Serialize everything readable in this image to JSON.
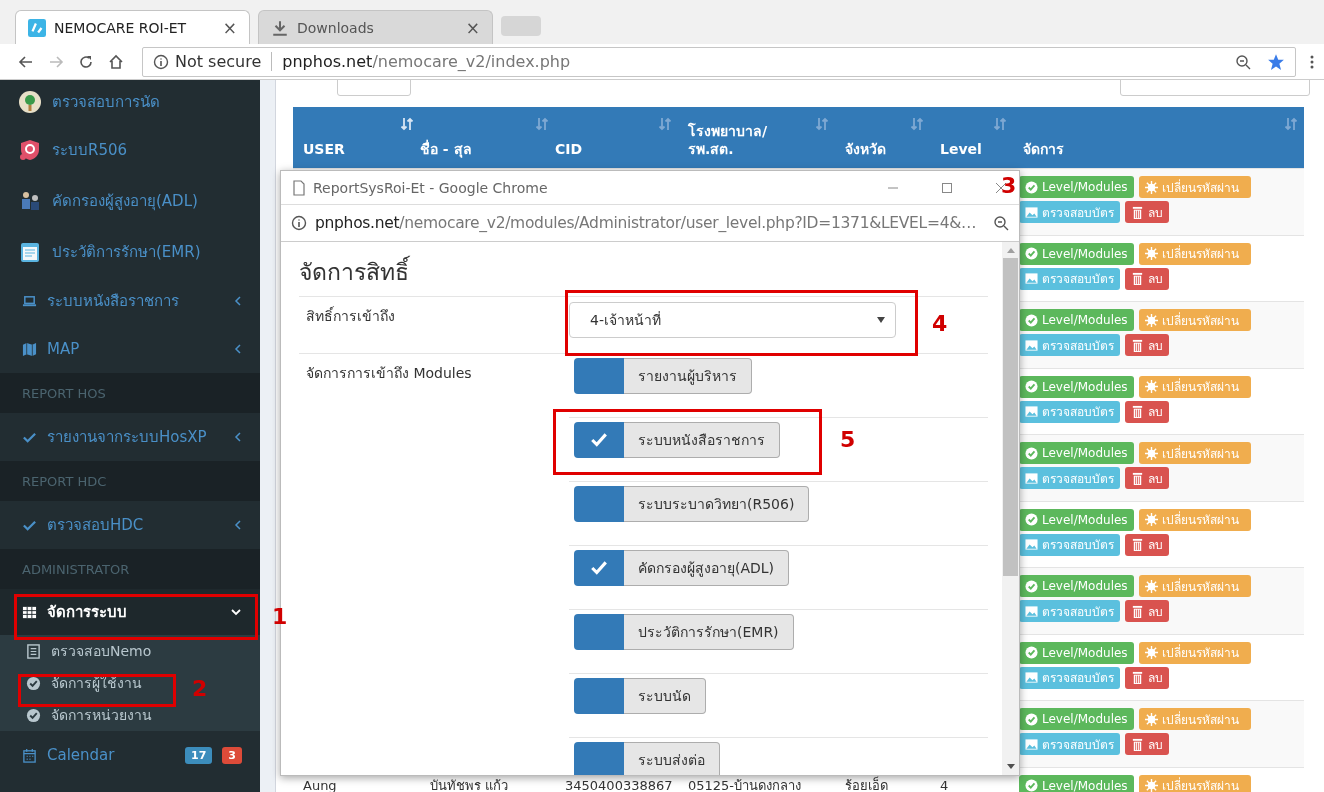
{
  "browser": {
    "tabs": [
      {
        "label": "NEMOCARE ROI-ET",
        "selected": true,
        "close": "×"
      },
      {
        "label": "Downloads",
        "selected": false,
        "close": "×"
      }
    ],
    "address": {
      "security": "Not secure",
      "host": "pnphos.net",
      "path": "/nemocare_v2/index.php"
    }
  },
  "sidebar": {
    "items": [
      {
        "kind": "item",
        "label": "ตรวจสอบการนัด",
        "selected": false
      },
      {
        "kind": "item",
        "label": "ระบบR506",
        "selected": false
      },
      {
        "kind": "item",
        "label": "คัดกรองผู้สูงอายุ(ADL)",
        "selected": false
      },
      {
        "kind": "item",
        "label": "ประวัติการรักษา(EMR)",
        "selected": false
      },
      {
        "kind": "item",
        "label": "ระบบหนังสือราชการ",
        "selected": false,
        "expanded": false
      },
      {
        "kind": "item",
        "label": "MAP",
        "selected": false,
        "expanded": false
      },
      {
        "kind": "header",
        "label": "REPORT HOS"
      },
      {
        "kind": "item",
        "label": "รายงานจากระบบHosXP",
        "selected": false,
        "expanded": false
      },
      {
        "kind": "header",
        "label": "REPORT HDC"
      },
      {
        "kind": "item",
        "label": "ตรวจสอบHDC",
        "selected": false,
        "expanded": false
      },
      {
        "kind": "header",
        "label": "ADMINISTRATOR"
      },
      {
        "kind": "item",
        "label": "จัดการระบบ",
        "selected": true,
        "expanded": true,
        "children": [
          {
            "label": "ตรวจสอบNemo",
            "selected": false
          },
          {
            "label": "จัดการผู้ใช้งาน",
            "selected": false
          },
          {
            "label": "จัดการหน่วยงาน",
            "selected": false
          }
        ]
      },
      {
        "kind": "item",
        "label": "Calendar",
        "selected": false,
        "badges": [
          {
            "text": "17",
            "color": "#3c8dbc"
          },
          {
            "text": "3",
            "color": "#dd4b39"
          }
        ]
      }
    ]
  },
  "table": {
    "columns": [
      {
        "label": "USER",
        "sorted": true
      },
      {
        "label": "ชื่อ - สุล",
        "sorted": false
      },
      {
        "label": "CID",
        "sorted": false
      },
      {
        "label": "โรงพยาบาล/ รพ.สต.",
        "sorted": false
      },
      {
        "label": "จังหวัด",
        "sorted": false
      },
      {
        "label": "Level",
        "sorted": false
      },
      {
        "label": "จัดการ",
        "sorted": false
      }
    ],
    "rows": [
      {
        "actions": [
          {
            "kind": "level",
            "label": "Level/Modules"
          },
          {
            "kind": "password",
            "label": "เปลี่ยนรหัสผ่าน"
          },
          {
            "kind": "card",
            "label": "ตรวจสอบบัตร"
          },
          {
            "kind": "delete",
            "label": "ลบ"
          }
        ]
      },
      {
        "actions": [
          {
            "kind": "level",
            "label": "Level/Modules"
          },
          {
            "kind": "password",
            "label": "เปลี่ยนรหัสผ่าน"
          },
          {
            "kind": "card",
            "label": "ตรวจสอบบัตร"
          },
          {
            "kind": "delete",
            "label": "ลบ"
          }
        ]
      },
      {
        "actions": [
          {
            "kind": "level",
            "label": "Level/Modules"
          },
          {
            "kind": "password",
            "label": "เปลี่ยนรหัสผ่าน"
          },
          {
            "kind": "card",
            "label": "ตรวจสอบบัตร"
          },
          {
            "kind": "delete",
            "label": "ลบ"
          }
        ]
      },
      {
        "actions": [
          {
            "kind": "level",
            "label": "Level/Modules"
          },
          {
            "kind": "password",
            "label": "เปลี่ยนรหัสผ่าน"
          },
          {
            "kind": "card",
            "label": "ตรวจสอบบัตร"
          },
          {
            "kind": "delete",
            "label": "ลบ"
          }
        ]
      },
      {
        "actions": [
          {
            "kind": "level",
            "label": "Level/Modules"
          },
          {
            "kind": "password",
            "label": "เปลี่ยนรหัสผ่าน"
          },
          {
            "kind": "card",
            "label": "ตรวจสอบบัตร"
          },
          {
            "kind": "delete",
            "label": "ลบ"
          }
        ]
      },
      {
        "actions": [
          {
            "kind": "level",
            "label": "Level/Modules"
          },
          {
            "kind": "password",
            "label": "เปลี่ยนรหัสผ่าน"
          },
          {
            "kind": "card",
            "label": "ตรวจสอบบัตร"
          },
          {
            "kind": "delete",
            "label": "ลบ"
          }
        ]
      },
      {
        "actions": [
          {
            "kind": "level",
            "label": "Level/Modules"
          },
          {
            "kind": "password",
            "label": "เปลี่ยนรหัสผ่าน"
          },
          {
            "kind": "card",
            "label": "ตรวจสอบบัตร"
          },
          {
            "kind": "delete",
            "label": "ลบ"
          }
        ]
      },
      {
        "actions": [
          {
            "kind": "level",
            "label": "Level/Modules"
          },
          {
            "kind": "password",
            "label": "เปลี่ยนรหัสผ่าน"
          },
          {
            "kind": "card",
            "label": "ตรวจสอบบัตร"
          },
          {
            "kind": "delete",
            "label": "ลบ"
          }
        ]
      },
      {
        "actions": [
          {
            "kind": "level",
            "label": "Level/Modules"
          },
          {
            "kind": "password",
            "label": "เปลี่ยนรหัสผ่าน"
          },
          {
            "kind": "card",
            "label": "ตรวจสอบบัตร"
          },
          {
            "kind": "delete",
            "label": "ลบ"
          }
        ]
      },
      {
        "cells": [
          "Aung",
          "บันทัชพร แก้ว",
          "3450400338867",
          "05125-บ้านดงกลาง",
          "ร้อยเอ็ด",
          "4"
        ],
        "actions": [
          {
            "kind": "level",
            "label": "Level/Modules"
          },
          {
            "kind": "password",
            "label": "เปลี่ยนรหัสผ่าน"
          }
        ]
      }
    ]
  },
  "popup": {
    "title": "ReportSysRoi-Et - Google Chrome",
    "url_host": "pnphos.net",
    "url_path": "/nemocare_v2/modules/Administrator/user_level.php?ID=1371&LEVEL=4&…",
    "heading": "จัดการสิทธิ์",
    "access_label": "สิทธิ์การเข้าถึง",
    "access_value": "4-เจ้าหน้าที่",
    "modules_label": "จัดการการเข้าถึง Modules",
    "modules": [
      {
        "label": "รายงานผู้บริหาร",
        "checked": false
      },
      {
        "label": "ระบบหนังสือราชการ",
        "checked": true
      },
      {
        "label": "ระบบระบาดวิทยา(R506)",
        "checked": false
      },
      {
        "label": "คัดกรองผู้สูงอายุ(ADL)",
        "checked": true
      },
      {
        "label": "ประวัติการรักษา(EMR)",
        "checked": false
      },
      {
        "label": "ระบบนัด",
        "checked": false
      },
      {
        "label": "ระบบส่งต่อ",
        "checked": false
      }
    ]
  },
  "annotations": [
    {
      "number": "1"
    },
    {
      "number": "2"
    },
    {
      "number": "3"
    },
    {
      "number": "4"
    },
    {
      "number": "5"
    }
  ]
}
